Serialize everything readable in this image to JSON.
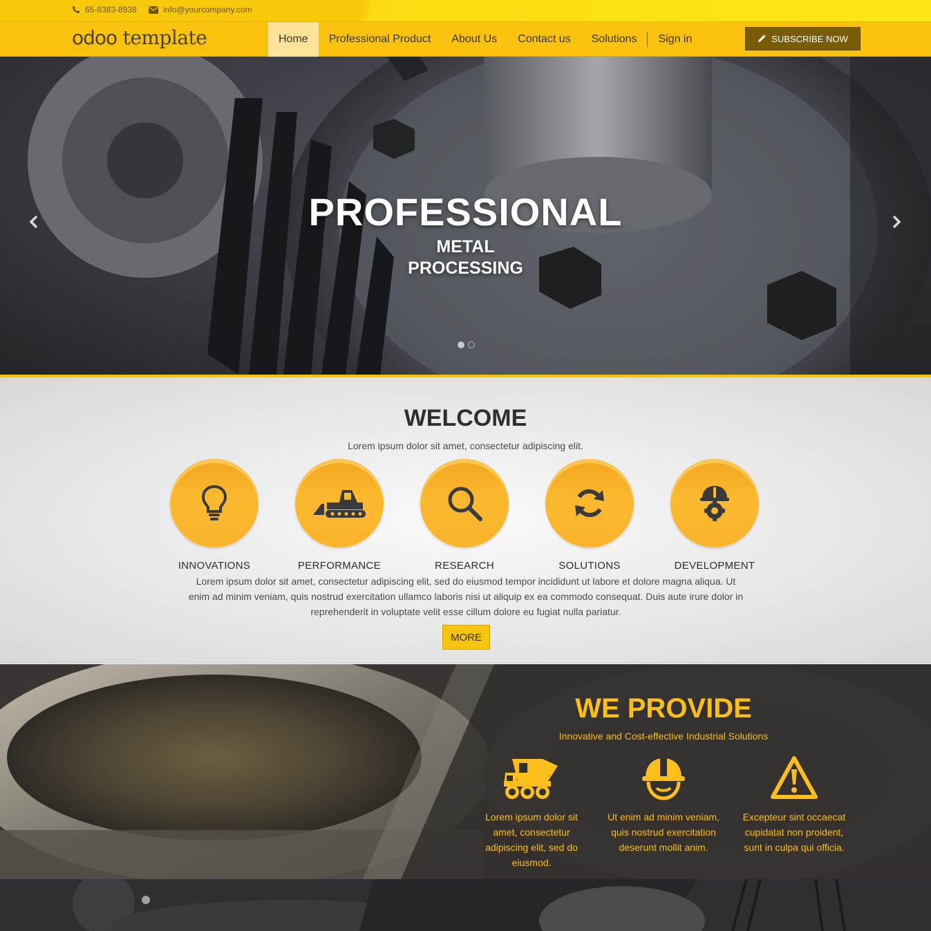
{
  "topbar": {
    "phone": "65-8383-8938",
    "email": "info@yourcompany.com",
    "phone_icon": "phone-icon",
    "email_icon": "envelope-icon"
  },
  "navbar": {
    "logo_part1": "odoo",
    "logo_part2": " template",
    "items": [
      {
        "label": "Home",
        "active": true
      },
      {
        "label": "Professional Product",
        "active": false
      },
      {
        "label": "About Us",
        "active": false
      },
      {
        "label": "Contact us",
        "active": false
      },
      {
        "label": "Solutions",
        "active": false
      },
      {
        "label": "Sign in",
        "active": false
      }
    ],
    "subscribe_label": "SUBSCRIBE NOW",
    "subscribe_icon": "pencil-icon"
  },
  "hero": {
    "title": "PROFESSIONAL",
    "subtitle_line1": "METAL",
    "subtitle_line2": "PROCESSING",
    "prev_icon": "chevron-left-icon",
    "next_icon": "chevron-right-icon",
    "slides": 2,
    "active_slide": 1
  },
  "welcome": {
    "title": "WELCOME",
    "lead": "Lorem ipsum dolor sit amet, consectetur adipiscing elit.",
    "features": [
      {
        "label": "INNOVATIONS",
        "icon": "lightbulb-icon"
      },
      {
        "label": "PERFORMANCE",
        "icon": "bulldozer-icon"
      },
      {
        "label": "RESEARCH",
        "icon": "search-icon"
      },
      {
        "label": "SOLUTIONS",
        "icon": "refresh-icon"
      },
      {
        "label": "DEVELOPMENT",
        "icon": "hardhat-gear-icon"
      }
    ],
    "body": "Lorem ipsum dolor sit amet, consectetur adipiscing elit, sed do eiusmod tempor incididunt ut labore et dolore magna aliqua. Ut enim ad minim veniam, quis nostrud exercitation ullamco laboris nisi ut aliquip ex ea commodo consequat. Duis aute irure dolor in reprehenderit in voluptate velit esse cillum dolore eu fugiat nulla pariatur.",
    "more_label": "MORE"
  },
  "provide": {
    "title": "WE PROVIDE",
    "subtitle": "Innovative and Cost-effective Industrial Solutions",
    "columns": [
      {
        "icon": "dump-truck-icon",
        "text": "Lorem ipsum dolor sit amet, consectetur adipiscing elit, sed do eiusmod."
      },
      {
        "icon": "worker-helmet-icon",
        "text": "Ut enim ad minim veniam, quis nostrud exercitation deserunt mollit anim."
      },
      {
        "icon": "warning-icon",
        "text": "Excepteur sint occaecat cupidatat non proident, sunt in culpa qui officia."
      }
    ]
  },
  "colors": {
    "brand_yellow": "#f9c20f",
    "accent_orange": "#fbb930",
    "provide_text": "#fcbe1a",
    "subscribe_bg": "#7a5c06"
  }
}
